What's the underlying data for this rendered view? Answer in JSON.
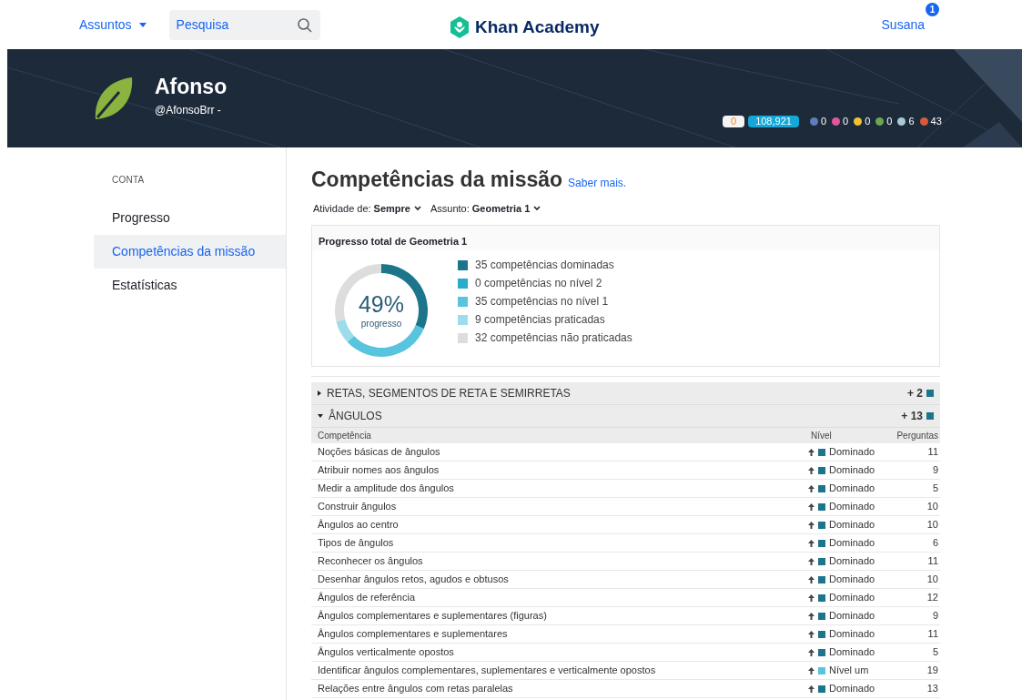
{
  "nav": {
    "subjects": "Assuntos",
    "search": {
      "placeholder": "Pesquisa"
    },
    "logo": "Khan Academy",
    "user": "Susana",
    "notifications": "1"
  },
  "profile": {
    "name": "Afonso",
    "username": "@AfonsoBrr -",
    "energy": "0",
    "points": "108,921",
    "badges": [
      {
        "color": "#5b7fb8",
        "count": "0"
      },
      {
        "color": "#e0559b",
        "count": "0"
      },
      {
        "color": "#f1c232",
        "count": "0"
      },
      {
        "color": "#6aa84f",
        "count": "0"
      },
      {
        "color": "#a9c9d6",
        "count": "6"
      },
      {
        "color": "#d9593d",
        "count": "43"
      }
    ]
  },
  "sidebar": {
    "heading": "CONTA",
    "items": [
      {
        "label": "Progresso",
        "selected": false
      },
      {
        "label": "Competências da missão",
        "selected": true
      },
      {
        "label": "Estatísticas",
        "selected": false
      }
    ]
  },
  "main": {
    "title": "Competências da missão",
    "learn_more": "Saber mais.",
    "filters": [
      {
        "label": "Atividade de:",
        "value": "Sempre"
      },
      {
        "label": "Assunto:",
        "value": "Geometria 1"
      }
    ],
    "progress": {
      "title": "Progresso total de Geometria 1",
      "percent": "49%",
      "caption": "progresso",
      "chart_data": {
        "type": "donut",
        "categories": [
          "35 competências dominadas",
          "0 competências no nível 2",
          "35 competências no nível 1",
          "9 competências praticadas",
          "32 competências não praticadas"
        ],
        "values": [
          35,
          0,
          35,
          9,
          32
        ],
        "colors": [
          "#1c758a",
          "#29abca",
          "#58c4dd",
          "#9cdceb",
          "#dddddd"
        ]
      }
    },
    "columns": [
      "Competência",
      "Nível",
      "Perguntas"
    ],
    "sections": [
      {
        "title": "RETAS, SEGMENTOS DE RETA E SEMIRRETAS",
        "gain": "+ 2",
        "expanded": false
      },
      {
        "title": "ÂNGULOS",
        "gain": "+ 13",
        "expanded": true,
        "rows": [
          {
            "skill": "Noções básicas de ângulos",
            "level": "Dominado",
            "color": "#1c758a",
            "questions": "11"
          },
          {
            "skill": "Atribuir nomes aos ângulos",
            "level": "Dominado",
            "color": "#1c758a",
            "questions": "9"
          },
          {
            "skill": "Medir a amplitude dos ângulos",
            "level": "Dominado",
            "color": "#1c758a",
            "questions": "5"
          },
          {
            "skill": "Construir ângulos",
            "level": "Dominado",
            "color": "#1c758a",
            "questions": "10"
          },
          {
            "skill": "Ângulos ao centro",
            "level": "Dominado",
            "color": "#1c758a",
            "questions": "10"
          },
          {
            "skill": "Tipos de ângulos",
            "level": "Dominado",
            "color": "#1c758a",
            "questions": "6"
          },
          {
            "skill": "Reconhecer os ângulos",
            "level": "Dominado",
            "color": "#1c758a",
            "questions": "11"
          },
          {
            "skill": "Desenhar ângulos retos, agudos e obtusos",
            "level": "Dominado",
            "color": "#1c758a",
            "questions": "10"
          },
          {
            "skill": "Ângulos de referência",
            "level": "Dominado",
            "color": "#1c758a",
            "questions": "12"
          },
          {
            "skill": "Ângulos complementares e suplementares (figuras)",
            "level": "Dominado",
            "color": "#1c758a",
            "questions": "9"
          },
          {
            "skill": "Ângulos complementares e suplementares",
            "level": "Dominado",
            "color": "#1c758a",
            "questions": "11"
          },
          {
            "skill": "Ângulos verticalmente opostos",
            "level": "Dominado",
            "color": "#1c758a",
            "questions": "5"
          },
          {
            "skill": "Identificar ângulos complementares, suplementares e verticalmente opostos",
            "level": "Nível um",
            "color": "#58c4dd",
            "questions": "19"
          },
          {
            "skill": "Relações entre ângulos com retas paralelas",
            "level": "Dominado",
            "color": "#1c758a",
            "questions": "13"
          }
        ]
      }
    ]
  }
}
